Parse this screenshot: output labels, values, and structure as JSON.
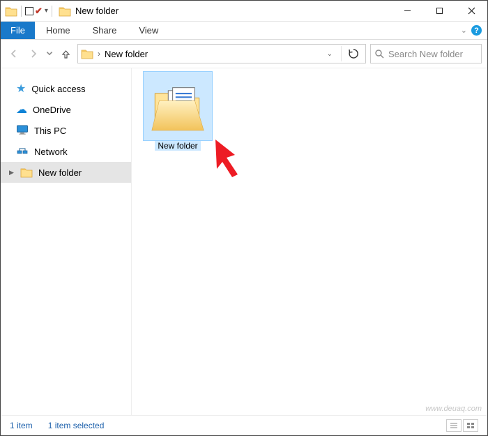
{
  "window": {
    "title": "New folder",
    "controls": {
      "minimize": "–",
      "maximize": "☐",
      "close": "✕"
    }
  },
  "ribbon": {
    "file": "File",
    "tabs": [
      "Home",
      "Share",
      "View"
    ]
  },
  "address": {
    "path": "New folder",
    "chevron": "›",
    "refresh": "↻"
  },
  "search": {
    "placeholder": "Search New folder"
  },
  "sidebar": {
    "items": [
      {
        "label": "Quick access",
        "icon": "star"
      },
      {
        "label": "OneDrive",
        "icon": "cloud"
      },
      {
        "label": "This PC",
        "icon": "monitor"
      },
      {
        "label": "Network",
        "icon": "network"
      },
      {
        "label": "New folder",
        "icon": "folder",
        "selected": true
      }
    ]
  },
  "content": {
    "items": [
      {
        "label": "New folder",
        "selected": true
      }
    ]
  },
  "status": {
    "count": "1 item",
    "selected": "1 item selected"
  },
  "watermark": "www.deuaq.com"
}
